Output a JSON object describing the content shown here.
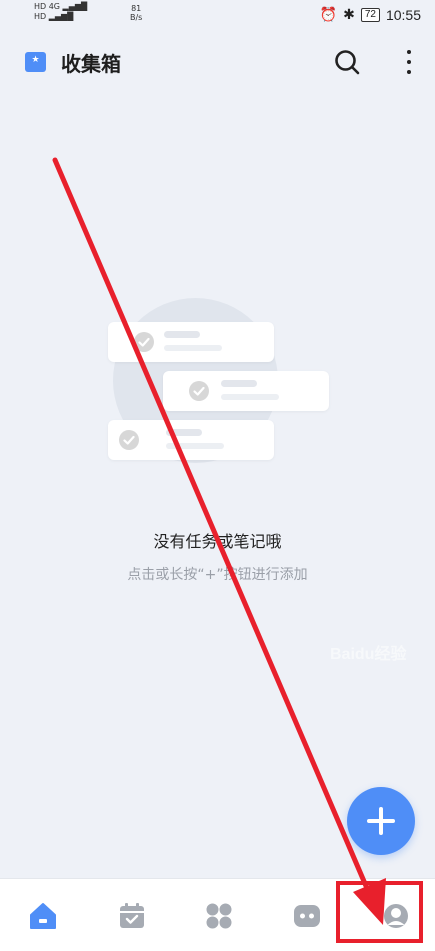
{
  "status_bar": {
    "network": "HD 4G",
    "speed_value": "81",
    "speed_unit": "B/s",
    "battery": "72",
    "time": "10:55"
  },
  "header": {
    "title": "收集箱",
    "logo_icon": "inbox-star-icon",
    "search_icon": "search-icon",
    "more_icon": "more-vertical-icon"
  },
  "empty_state": {
    "title": "没有任务或笔记哦",
    "hint": "点击或长按“+”按钮进行添加"
  },
  "fab": {
    "icon": "plus-icon",
    "color": "#4f8ef7"
  },
  "bottom_nav": {
    "items": [
      {
        "icon": "home-icon",
        "active": true
      },
      {
        "icon": "calendar-check-icon",
        "active": false
      },
      {
        "icon": "apps-grid-icon",
        "active": false
      },
      {
        "icon": "chat-bubble-icon",
        "active": false
      },
      {
        "icon": "profile-icon",
        "active": false
      }
    ]
  },
  "annotation": {
    "color": "#e8202c",
    "watermark": "Baidu经验"
  },
  "colors": {
    "accent": "#4f8ef7",
    "background": "#eef1f7",
    "nav_inactive": "#a6abb3"
  }
}
